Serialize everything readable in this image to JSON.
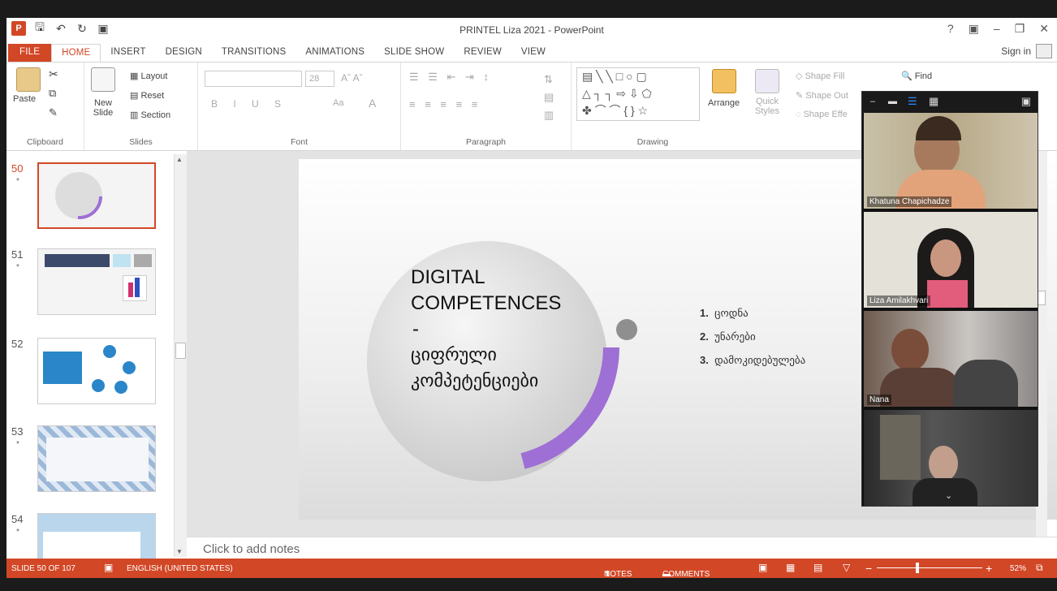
{
  "window": {
    "title": "PRINTEL Liza 2021 - PowerPoint"
  },
  "tabs": [
    "FILE",
    "HOME",
    "INSERT",
    "DESIGN",
    "TRANSITIONS",
    "ANIMATIONS",
    "SLIDE SHOW",
    "REVIEW",
    "VIEW"
  ],
  "signin": "Sign in",
  "ribbon": {
    "clipboard": {
      "paste": "Paste",
      "label": "Clipboard"
    },
    "slides": {
      "new_slide_1": "New",
      "new_slide_2": "Slide",
      "layout": "Layout",
      "reset": "Reset",
      "section": "Section",
      "label": "Slides"
    },
    "font": {
      "size": "28",
      "label": "Font",
      "aa": "Aa"
    },
    "paragraph": {
      "label": "Paragraph"
    },
    "drawing": {
      "arrange": "Arrange",
      "quick_styles_1": "Quick",
      "quick_styles_2": "Styles",
      "shape_fill": "Shape Fill",
      "shape_outline": "Shape Out",
      "shape_effects": "Shape Effe",
      "label": "Drawing"
    },
    "editing": {
      "find": "Find"
    }
  },
  "thumbnails": [
    {
      "num": "50",
      "star": "*",
      "selected": true
    },
    {
      "num": "51",
      "star": "*",
      "selected": false
    },
    {
      "num": "52",
      "star": "",
      "selected": false
    },
    {
      "num": "53",
      "star": "*",
      "selected": false
    },
    {
      "num": "54",
      "star": "*",
      "selected": false
    }
  ],
  "slide": {
    "title_line1": "DIGITAL",
    "title_line2": "COMPETENCES",
    "dash": "-",
    "georgian_line1": "ციფრული",
    "georgian_line2": "კომპეტენციები",
    "list": [
      {
        "n": "1.",
        "t": "ცოდნა"
      },
      {
        "n": "2.",
        "t": "უნარები"
      },
      {
        "n": "3.",
        "t": "დამოკიდებულება"
      }
    ]
  },
  "notes_placeholder": "Click to add notes",
  "status": {
    "slide": "SLIDE 50 OF 107",
    "language": "ENGLISH (UNITED STATES)",
    "notes": "NOTES",
    "comments": "COMMENTS",
    "zoom": "52%"
  },
  "zoom_panel": {
    "participants": [
      "Khatuna Chapichadze",
      "Liza Amilakhvari",
      "Nana",
      ""
    ]
  },
  "colors": {
    "accent": "#d24726",
    "arc": "#9e6fd4"
  }
}
